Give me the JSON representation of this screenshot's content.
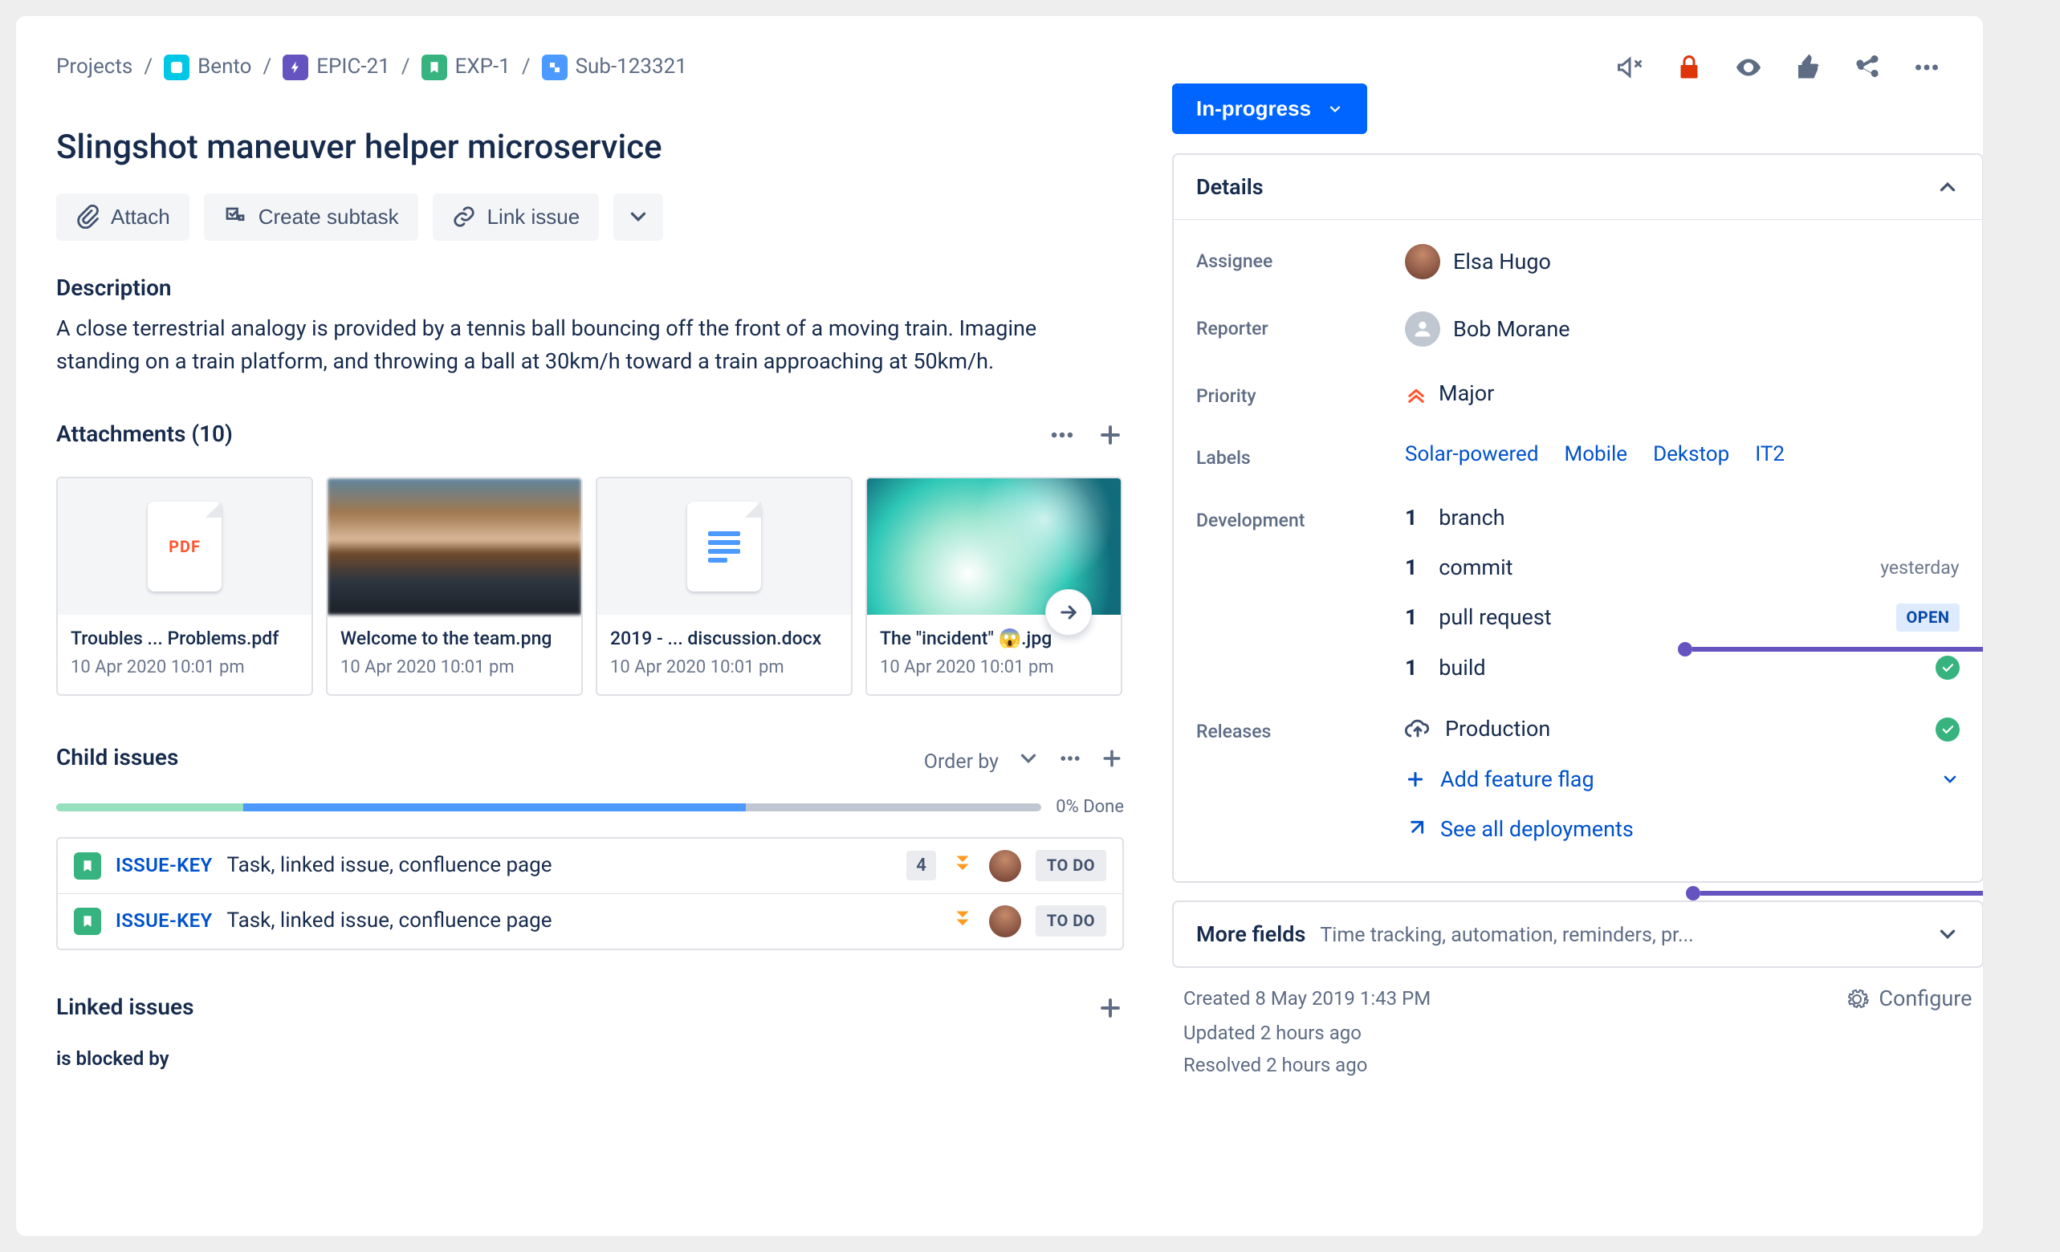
{
  "breadcrumbs": {
    "root": "Projects",
    "project": "Bento",
    "epic": "EPIC-21",
    "story": "EXP-1",
    "subtask": "Sub-123321"
  },
  "page_title": "Slingshot maneuver helper microservice",
  "action_buttons": {
    "attach": "Attach",
    "create_subtask": "Create subtask",
    "link_issue": "Link issue"
  },
  "description": {
    "heading": "Description",
    "body": "A close terrestrial analogy is provided by a tennis ball bouncing off the front of a moving train. Imagine standing on a train platform, and throwing a ball at 30km/h toward a train approaching at 50km/h."
  },
  "attachments": {
    "heading": "Attachments (10)",
    "items": [
      {
        "name": "Troubles ... Problems.pdf",
        "date": "10 Apr 2020 10:01 pm",
        "type": "pdf"
      },
      {
        "name": "Welcome to the team.png",
        "date": "10 Apr 2020 10:01 pm",
        "type": "img1"
      },
      {
        "name": "2019 - ... discussion.docx",
        "date": "10 Apr 2020 10:01 pm",
        "type": "doc"
      },
      {
        "name": "The \"incident\" 😱.jpg",
        "date": "10 Apr 2020 10:01 pm",
        "type": "img2"
      }
    ]
  },
  "child_issues": {
    "heading": "Child issues",
    "order_by_label": "Order by",
    "progress": {
      "done_pct": 19,
      "prog_pct": 51,
      "label": "0% Done"
    },
    "rows": [
      {
        "key": "ISSUE-KEY",
        "summary": "Task, linked issue, confluence page",
        "count": "4",
        "status": "TO DO",
        "has_count": true
      },
      {
        "key": "ISSUE-KEY",
        "summary": "Task, linked issue, confluence page",
        "status": "TO DO",
        "has_count": false
      }
    ]
  },
  "linked_issues": {
    "heading": "Linked issues",
    "blocked_by_label": "is blocked by"
  },
  "status": {
    "label": "In-progress"
  },
  "details": {
    "heading": "Details",
    "assignee_label": "Assignee",
    "assignee_value": "Elsa Hugo",
    "reporter_label": "Reporter",
    "reporter_value": "Bob Morane",
    "priority_label": "Priority",
    "priority_value": "Major",
    "labels_label": "Labels",
    "labels": [
      "Solar-powered",
      "Mobile",
      "Dekstop",
      "IT2"
    ],
    "development_label": "Development",
    "development": {
      "branch_count": "1",
      "branch_word": "branch",
      "commit_count": "1",
      "commit_word": "commit",
      "commit_meta": "yesterday",
      "pr_count": "1",
      "pr_word": "pull request",
      "pr_badge": "OPEN",
      "build_count": "1",
      "build_word": "build"
    },
    "releases_label": "Releases",
    "releases": {
      "env": "Production",
      "add_flag": "Add feature flag",
      "see_all": "See all deployments"
    }
  },
  "more_fields": {
    "title": "More fields",
    "sub": "Time tracking, automation, reminders, pr..."
  },
  "meta": {
    "created": "Created 8 May 2019 1:43 PM",
    "updated": "Updated 2 hours ago",
    "resolved": "Resolved 2 hours ago",
    "configure": "Configure"
  },
  "annotations": {
    "a1": "1",
    "a2": "2"
  }
}
